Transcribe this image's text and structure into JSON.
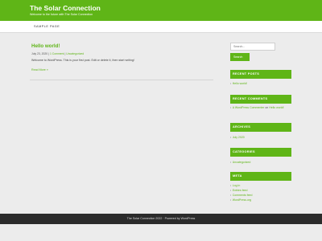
{
  "header": {
    "site_title": "The Solar Connection",
    "tagline": "Welcome to the future with The Solar Connection",
    "background_color": "#5fb517"
  },
  "nav": {
    "items": [
      {
        "label": "Sample Page"
      }
    ]
  },
  "post": {
    "title": "Hello world!",
    "date": "July 23, 2020",
    "comments_link": "1 Comment",
    "separator": "|",
    "category": "Uncategorized",
    "excerpt": "Welcome to WordPress. This is your first post. Edit or delete it, then start writing!",
    "read_more": "Read More »"
  },
  "sidebar": {
    "search": {
      "placeholder": "Search...",
      "button_label": "Search"
    },
    "recent_posts": {
      "heading": "Recent Posts",
      "items": [
        {
          "label": "Hello world!"
        }
      ]
    },
    "recent_comments": {
      "heading": "Recent Comments",
      "items": [
        {
          "author": "A WordPress Commenter",
          "connector": "on",
          "post": "Hello world!"
        }
      ]
    },
    "archives": {
      "heading": "Archives",
      "items": [
        {
          "label": "July 2020"
        }
      ]
    },
    "categories": {
      "heading": "Categories",
      "items": [
        {
          "label": "Uncategorized"
        }
      ]
    },
    "meta": {
      "heading": "Meta",
      "items": [
        {
          "label": "Log in"
        },
        {
          "label": "Entries feed"
        },
        {
          "label": "Comments feed"
        },
        {
          "label": "WordPress.org"
        }
      ]
    }
  },
  "footer": {
    "text": "The Solar Connection 2022 · Powered by WordPress",
    "background_color": "#2b2b2b"
  },
  "theme": {
    "accent_color": "#5fb517",
    "page_background": "#ececec"
  }
}
